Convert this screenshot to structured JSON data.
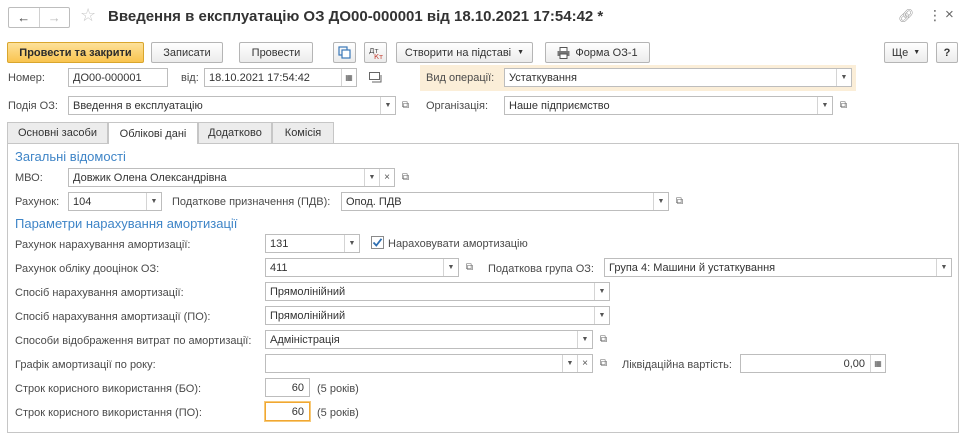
{
  "window": {
    "title": "Введення в експлуатацію ОЗ ДО00-000001 від 18.10.2021 17:54:42 *"
  },
  "toolbar": {
    "post_close": "Провести та закрити",
    "save": "Записати",
    "post": "Провести",
    "create_based": "Створити на підставі",
    "form_oz1": "Форма ОЗ-1",
    "more": "Ще",
    "help": "?"
  },
  "header": {
    "number_label": "Номер:",
    "number_value": "ДО00-000001",
    "date_label": "від:",
    "date_value": "18.10.2021 17:54:42",
    "operation_label": "Вид операції:",
    "operation_value": "Устаткування",
    "event_label": "Подія ОЗ:",
    "event_value": "Введення в експлуатацію",
    "org_label": "Організація:",
    "org_value": "Наше підприємство"
  },
  "tabs": [
    {
      "label": "Основні засоби"
    },
    {
      "label": "Облікові дані"
    },
    {
      "label": "Додатково"
    },
    {
      "label": "Комісія"
    }
  ],
  "general": {
    "section_title": "Загальні відомості",
    "mvo_label": "МВО:",
    "mvo_value": "Довжик Олена Олександрівна",
    "account_label": "Рахунок:",
    "account_value": "104",
    "tax_purpose_label": "Податкове призначення (ПДВ):",
    "tax_purpose_value": "Опод. ПДВ"
  },
  "depreciation": {
    "section_title": "Параметри нарахування амортизації",
    "dep_account_label": "Рахунок нарахування амортизації:",
    "dep_account_value": "131",
    "accrue_label": "Нараховувати амортизацію",
    "accrue_checked": true,
    "reval_account_label": "Рахунок обліку дооцінок ОЗ:",
    "reval_account_value": "411",
    "tax_group_label": "Податкова група ОЗ:",
    "tax_group_value": "Група 4: Машини й устаткування",
    "method_label": "Спосіб нарахування амортизації:",
    "method_value": "Прямолінійний",
    "method_po_label": "Спосіб нарахування амортизації (ПО):",
    "method_po_value": "Прямолінійний",
    "expense_label": "Способи відображення витрат по амортизації:",
    "expense_value": "Адміністрація",
    "schedule_label": "Графік амортизації по року:",
    "schedule_value": "",
    "residual_label": "Ліквідаційна вартість:",
    "residual_value": "0,00",
    "life_bo_label": "Строк корисного використання (БО):",
    "life_bo_value": "60",
    "life_bo_years": "(5 років)",
    "life_po_label": "Строк корисного використання (ПО):",
    "life_po_value": "60",
    "life_po_years": "(5 років)"
  },
  "colors": {
    "accent": "#3f85c7",
    "primary_button": "#f9c44f",
    "focus_border": "#f0a732"
  }
}
